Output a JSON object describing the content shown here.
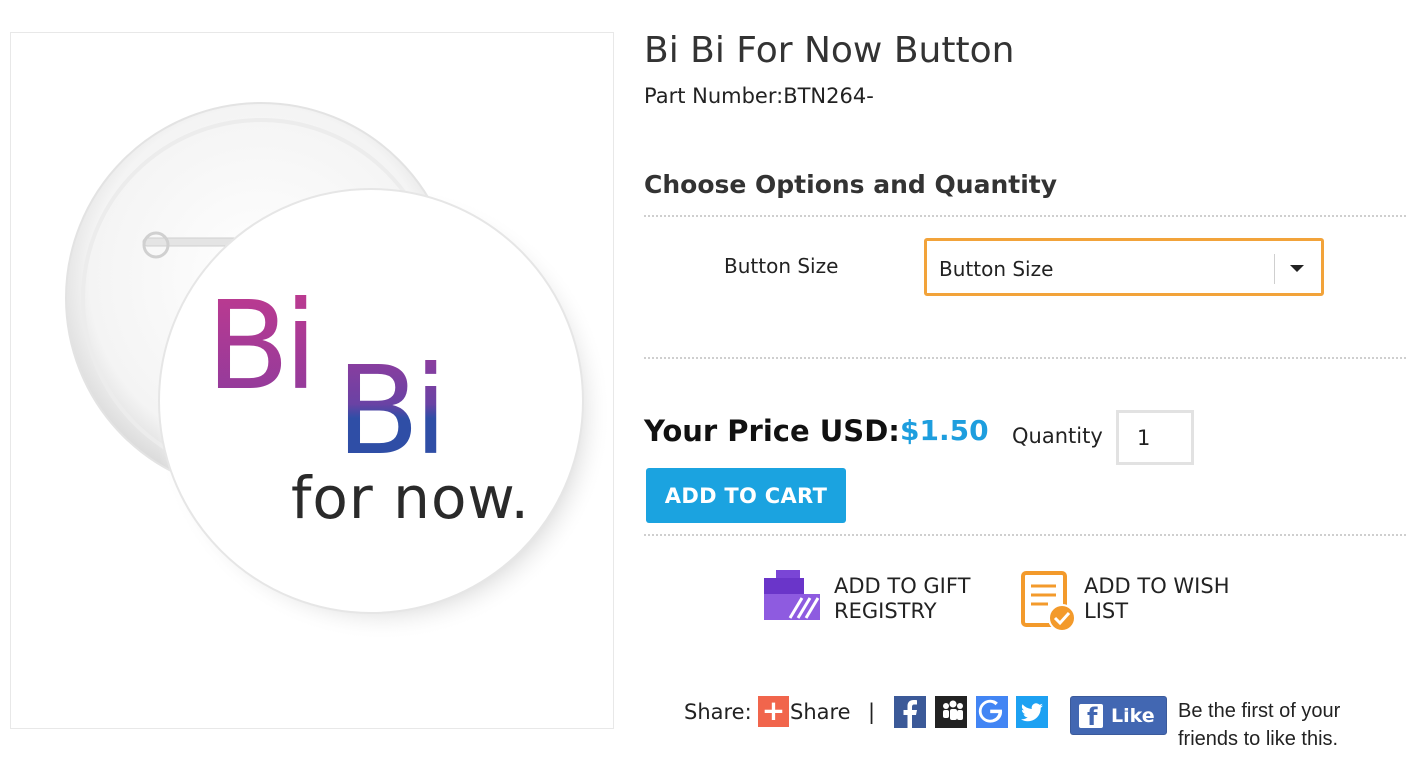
{
  "product": {
    "title": "Bi Bi For Now Button",
    "part_number": "Part Number:BTN264-",
    "image": {
      "line1": "Bi",
      "line2": "Bi",
      "line3": "for now.",
      "colors": {
        "pink": "#c23a8e",
        "purple": "#9a3b9c",
        "blue": "#2f4ea6"
      }
    }
  },
  "options": {
    "heading": "Choose Options and Quantity",
    "button_size": {
      "label": "Button Size",
      "selected": "Button Size"
    }
  },
  "purchase": {
    "price_label": "Your Price USD:",
    "price": "$1.50",
    "quantity_label": "Quantity",
    "quantity": "1",
    "add_to_cart": "ADD TO CART"
  },
  "actions": {
    "gift_registry": {
      "line1": "ADD TO GIFT",
      "line2": "REGISTRY"
    },
    "wish_list": {
      "line1": "ADD TO WISH",
      "line2": "LIST"
    }
  },
  "share": {
    "label": "Share:",
    "share_button": "Share",
    "separator": "|",
    "icons": [
      "facebook-icon",
      "myspace-icon",
      "google-icon",
      "twitter-icon"
    ],
    "like_button": "Like",
    "like_note": "Be the first of your friends to like this."
  },
  "colors": {
    "accent_blue": "#1ba3e0",
    "price_blue": "#1e9ede",
    "select_border": "#f2a33a",
    "share_plus": "#f1654c",
    "facebook": "#3b5998",
    "google": "#4285f4",
    "twitter": "#1da1f2",
    "gift_purple": "#6a35c9",
    "wish_orange": "#f39a2b"
  }
}
